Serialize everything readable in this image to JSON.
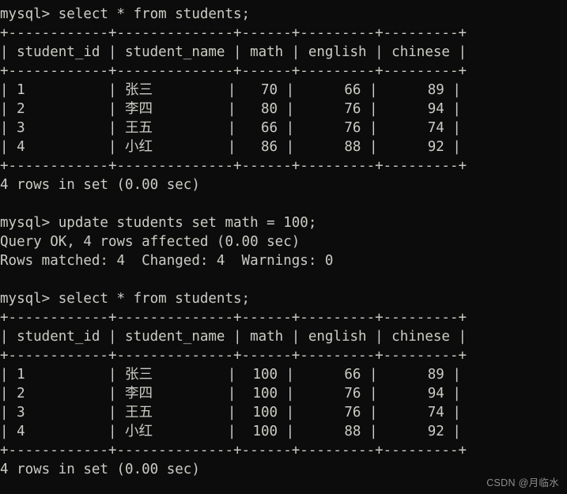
{
  "terminal": {
    "app": "mysql-client",
    "background_color": "#0c0c0c",
    "text_color": "#ccccc6",
    "watermark": "CSDN @月临水"
  },
  "session": {
    "prompt": "mysql> ",
    "commands": {
      "select_1": "select * from students;",
      "update": "update students set math = 100;",
      "select_2": "select * from students;"
    },
    "status": {
      "rows_in_set": "4 rows in set (0.00 sec)",
      "query_ok": "Query OK, 4 rows affected (0.00 sec)",
      "rows_matched": "Rows matched: 4  Changed: 4  Warnings: 0"
    }
  },
  "table": {
    "separator": "+------------+--------------+------+---------+---------+",
    "columns": [
      "student_id",
      "student_name",
      "math",
      "english",
      "chinese"
    ],
    "widths": [
      12,
      14,
      6,
      9,
      9
    ],
    "align": [
      "left",
      "left",
      "right",
      "right",
      "right"
    ]
  },
  "result_1": {
    "rows": [
      {
        "student_id": "1",
        "student_name": "张三",
        "math": "70",
        "english": "66",
        "chinese": "89"
      },
      {
        "student_id": "2",
        "student_name": "李四",
        "math": "80",
        "english": "76",
        "chinese": "94"
      },
      {
        "student_id": "3",
        "student_name": "王五",
        "math": "66",
        "english": "76",
        "chinese": "74"
      },
      {
        "student_id": "4",
        "student_name": "小红",
        "math": "86",
        "english": "88",
        "chinese": "92"
      }
    ]
  },
  "result_2": {
    "rows": [
      {
        "student_id": "1",
        "student_name": "张三",
        "math": "100",
        "english": "66",
        "chinese": "89"
      },
      {
        "student_id": "2",
        "student_name": "李四",
        "math": "100",
        "english": "76",
        "chinese": "94"
      },
      {
        "student_id": "3",
        "student_name": "王五",
        "math": "100",
        "english": "76",
        "chinese": "74"
      },
      {
        "student_id": "4",
        "student_name": "小红",
        "math": "100",
        "english": "88",
        "chinese": "92"
      }
    ]
  }
}
